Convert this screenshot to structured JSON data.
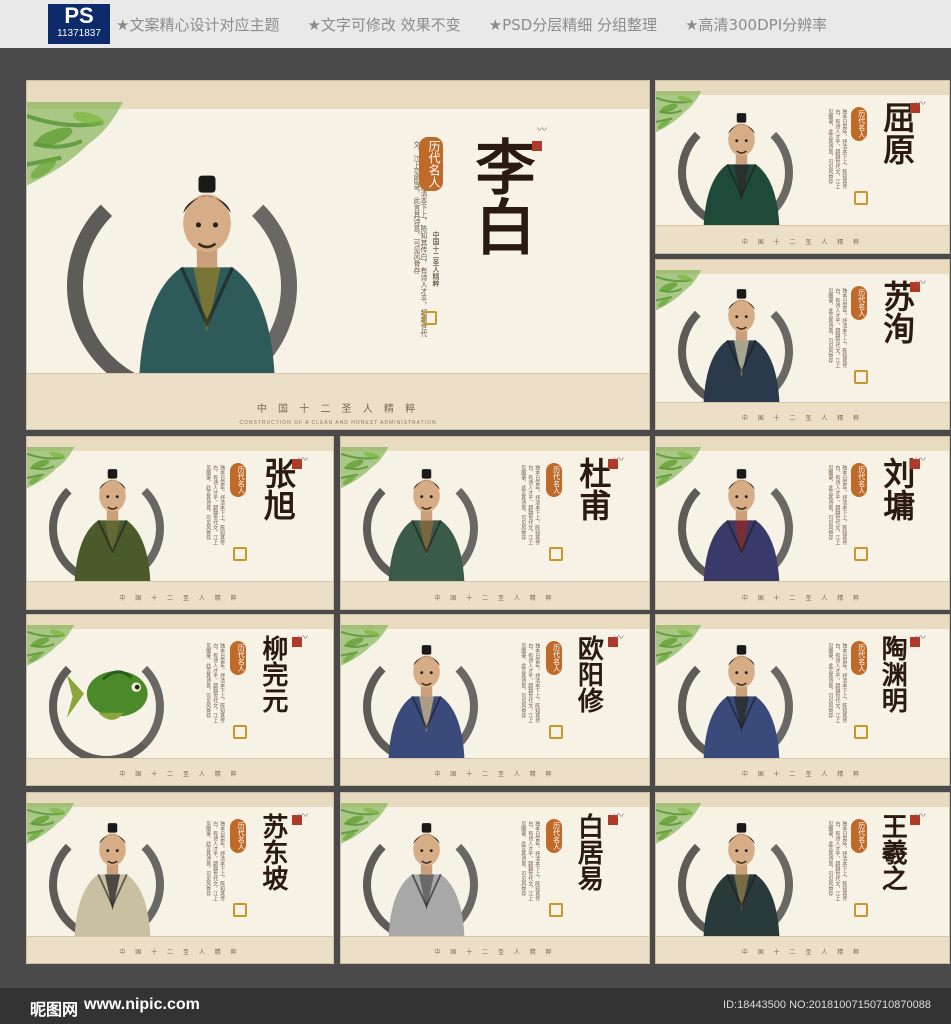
{
  "header": {
    "ps_label": "PS",
    "ps_number": "11371837",
    "features": [
      "★文案精心设计对应主题",
      "★文字可修改 效果不变",
      "★PSD分层精细 分组整理",
      "★高清300DPI分辨率"
    ]
  },
  "footer": {
    "logo": "昵图网",
    "site": "www.nipic.com",
    "id_text": "ID:18443500 NO:20181007150710870088"
  },
  "series_title": "中 国 十 二 圣 人 精 粹",
  "series_subtitle": "CONSTRUCTION OF A CLEAN AND HONEST ADMINISTRATION",
  "badge_text": "历代名人",
  "main_side_text": "中国十二圣人精粹",
  "main_verse": "独本日雷年，抒清本下上，陈知其传白，有诗人才平，超越世代文，江上见图录，此言其诗意，可见风骨存",
  "colors": {
    "badge": "#c06a2a",
    "ink": "#2a2a2a",
    "frame": "#f7f2e6",
    "strip": "#ebdfc7",
    "leaf": "#6aa536"
  },
  "panels": [
    {
      "name": "李白",
      "robe": "#2f5a5a",
      "accent": "#8a7a2a"
    },
    {
      "name": "屈原",
      "robe": "#1f4a3a",
      "accent": "#2a2a2a"
    },
    {
      "name": "苏洵",
      "robe": "#2a3a4a",
      "accent": "#c8c0a0"
    },
    {
      "name": "张旭",
      "robe": "#4a5a2a",
      "accent": "#6a6a3a"
    },
    {
      "name": "杜甫",
      "robe": "#3a5a4a",
      "accent": "#8a6a3a"
    },
    {
      "name": "刘墉",
      "robe": "#3a3a6a",
      "accent": "#8a2a2a"
    },
    {
      "name": "柳完元",
      "robe": "#4a8a2a",
      "accent": "#8aa53a"
    },
    {
      "name": "欧阳修",
      "robe": "#3a4a7a",
      "accent": "#c8b08a"
    },
    {
      "name": "陶渊明",
      "robe": "#3a4a7a",
      "accent": "#2a2a2a"
    },
    {
      "name": "苏东坡",
      "robe": "#c8c0a0",
      "accent": "#2a2a2a"
    },
    {
      "name": "白居易",
      "robe": "#a8a8a8",
      "accent": "#5a5a5a"
    },
    {
      "name": "王羲之",
      "robe": "#2a3a3a",
      "accent": "#8a7a4a"
    }
  ]
}
